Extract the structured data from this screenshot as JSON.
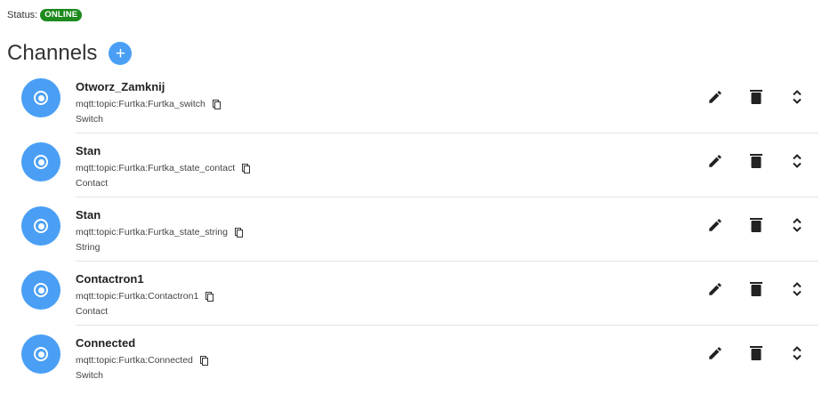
{
  "status": {
    "label": "Status:",
    "value": "ONLINE",
    "color": "#1e8a1e"
  },
  "header": {
    "title": "Channels",
    "add_label": "+"
  },
  "colors": {
    "accent": "#4a9ff5",
    "icon": "#222222"
  },
  "icons": {
    "avatar": "radio-button-icon",
    "copy": "copy-icon",
    "edit": "pencil-icon",
    "delete": "trash-icon",
    "expand": "unfold-more-icon"
  },
  "channels": [
    {
      "name": "Otworz_Zamknij",
      "uid": "mqtt:topic:Furtka:Furtka_switch",
      "type": "Switch"
    },
    {
      "name": "Stan",
      "uid": "mqtt:topic:Furtka:Furtka_state_contact",
      "type": "Contact"
    },
    {
      "name": "Stan",
      "uid": "mqtt:topic:Furtka:Furtka_state_string",
      "type": "String"
    },
    {
      "name": "Contactron1",
      "uid": "mqtt:topic:Furtka:Contactron1",
      "type": "Contact"
    },
    {
      "name": "Connected",
      "uid": "mqtt:topic:Furtka:Connected",
      "type": "Switch"
    }
  ]
}
